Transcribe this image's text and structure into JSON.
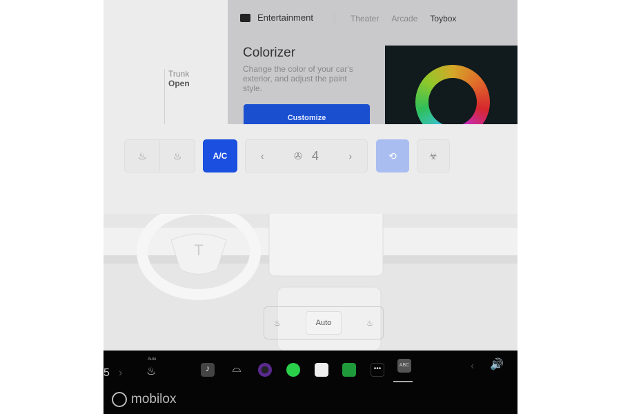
{
  "trunk": {
    "label": "Trunk",
    "state": "Open"
  },
  "entertainment": {
    "title": "Entertainment",
    "tabs": [
      "Theater",
      "Arcade",
      "Toybox"
    ],
    "active_tab": "Toybox",
    "card": {
      "title": "Colorizer",
      "description": "Change the color of your car's exterior, and adjust the paint style.",
      "button": "Customize"
    }
  },
  "climate": {
    "ac_label": "A/C",
    "fan_speed": "4",
    "seat_mode": "Auto",
    "accent": "#1a4fe0"
  },
  "dock": {
    "left_value": "5",
    "heat_label": "Auto",
    "apps": [
      "music",
      "wiper",
      "camera",
      "spotify",
      "calendar",
      "stocks",
      "more",
      "toybox"
    ],
    "active_app": "toybox"
  },
  "watermark": "mobilox"
}
